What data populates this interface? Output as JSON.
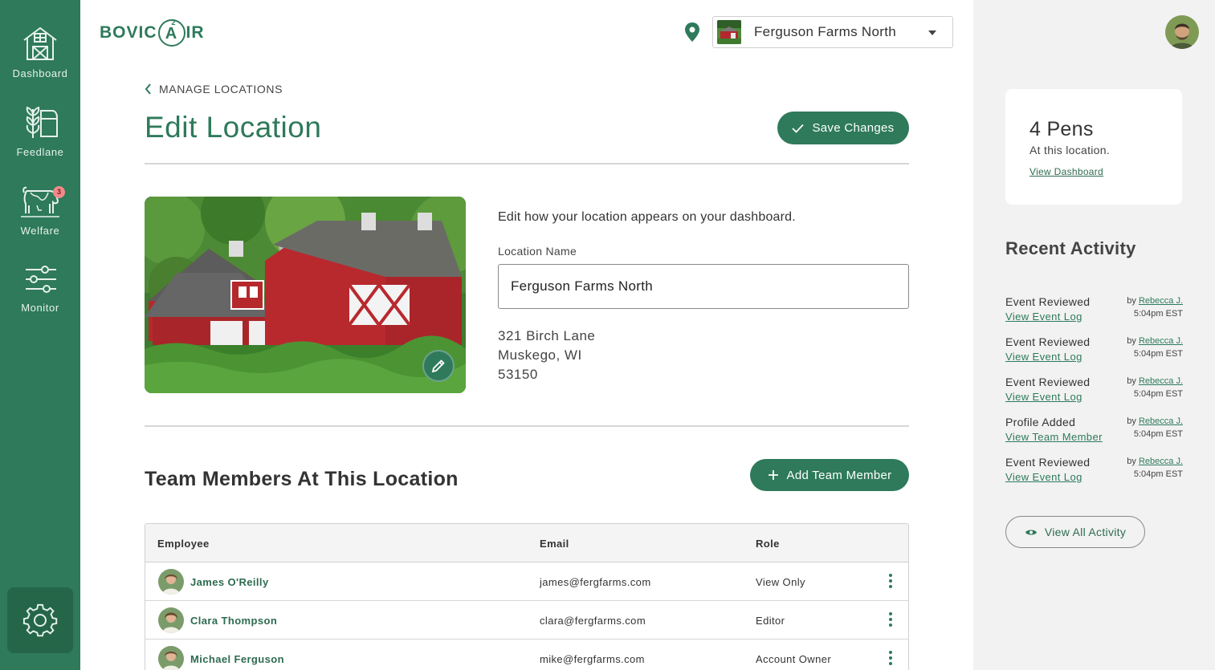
{
  "brand": {
    "logo_text_left": "BOVIC",
    "logo_ring_letter": "A",
    "logo_ring_sup": "2",
    "logo_text_right": "IR",
    "primary": "#2e7a5b"
  },
  "sidebar": {
    "items": [
      {
        "label": "Dashboard",
        "icon": "barn-icon"
      },
      {
        "label": "Feedlane",
        "icon": "wheat-icon"
      },
      {
        "label": "Welfare",
        "icon": "cow-icon",
        "badge": "3"
      },
      {
        "label": "Monitor",
        "icon": "sliders-icon"
      }
    ],
    "settings_icon": "gear-icon"
  },
  "header": {
    "location_select": {
      "value": "Ferguson Farms North"
    }
  },
  "main": {
    "back_label": "MANAGE LOCATIONS",
    "title": "Edit Location",
    "save_label": "Save Changes",
    "intro": "Edit how your location appears on your dashboard.",
    "name_label": "Location Name",
    "name_value": "Ferguson Farms North",
    "address": {
      "street": "321 Birch Lane",
      "city": "Muskego, WI",
      "zip": "53150"
    },
    "team_title": "Team Members At This Location",
    "add_label": "Add Team Member",
    "table": {
      "headers": {
        "employee": "Employee",
        "email": "Email",
        "role": "Role"
      },
      "rows": [
        {
          "name": "James O'Reilly",
          "email": "james@fergfarms.com",
          "role": "View Only"
        },
        {
          "name": "Clara Thompson",
          "email": "clara@fergfarms.com",
          "role": "Editor"
        },
        {
          "name": "Michael Ferguson",
          "email": "mike@fergfarms.com",
          "role": "Account Owner"
        }
      ]
    }
  },
  "right": {
    "pens": {
      "count": "4 Pens",
      "subtitle": "At this location.",
      "link": "View Dashboard"
    },
    "activity_title": "Recent Activity",
    "activity": [
      {
        "title": "Event Reviewed",
        "link": "View Event Log",
        "by_prefix": "by",
        "by_name": "Rebecca J.",
        "time": "5:04pm EST"
      },
      {
        "title": "Event Reviewed",
        "link": "View Event Log",
        "by_prefix": "by",
        "by_name": "Rebecca J.",
        "time": "5:04pm EST"
      },
      {
        "title": "Event Reviewed",
        "link": "View Event Log",
        "by_prefix": "by",
        "by_name": "Rebecca J.",
        "time": "5:04pm EST"
      },
      {
        "title": "Profile Added",
        "link": "View Team Member",
        "by_prefix": "by",
        "by_name": "Rebecca J.",
        "time": "5:04pm EST"
      },
      {
        "title": "Event Reviewed",
        "link": "View Event Log",
        "by_prefix": "by",
        "by_name": "Rebecca J.",
        "time": "5:04pm EST"
      }
    ],
    "view_all_label": "View All Activity"
  }
}
